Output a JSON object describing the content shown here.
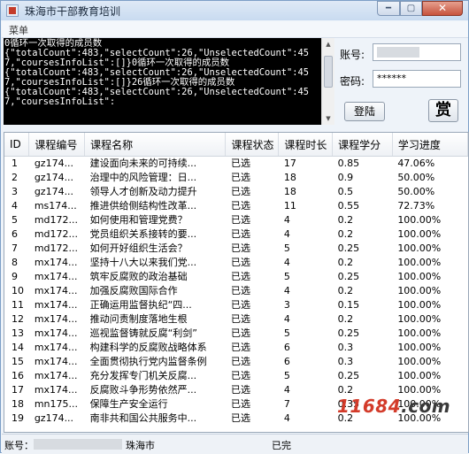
{
  "window": {
    "title": "珠海市干部教育培训"
  },
  "menu": {
    "label": "菜单"
  },
  "console": {
    "lines": "0循环一次取得的成员数\n{\"totalCount\":483,\"selectCount\":26,\"UnselectedCount\":457,\"coursesInfoList\":[]}0循环一次取得的成员数\n{\"totalCount\":483,\"selectCount\":26,\"UnselectedCount\":457,\"coursesInfoList\":[]}26循环一次取得的成员数\n{\"totalCount\":483,\"selectCount\":26,\"UnselectedCount\":457,\"coursesInfoList\":"
  },
  "login": {
    "account_label": "账号:",
    "password_label": "密码:",
    "password_value": "******",
    "login_button": "登陆",
    "reward_button": "赏"
  },
  "table": {
    "headers": [
      "ID",
      "课程编号",
      "课程名称",
      "课程状态",
      "课程时长",
      "课程学分",
      "学习进度"
    ],
    "rows": [
      [
        "1",
        "gz174...",
        "建设面向未来的可持续...",
        "已选",
        "17",
        "0.85",
        "47.06%"
      ],
      [
        "2",
        "gz174...",
        "治理中的风险管理：日...",
        "已选",
        "18",
        "0.9",
        "50.00%"
      ],
      [
        "3",
        "gz174...",
        "领导人才创新及动力提升",
        "已选",
        "18",
        "0.5",
        "50.00%"
      ],
      [
        "4",
        "ms174...",
        "推进供给侧结构性改革...",
        "已选",
        "11",
        "0.55",
        "72.73%"
      ],
      [
        "5",
        "md172...",
        "如何使用和管理党费？",
        "已选",
        "4",
        "0.2",
        "100.00%"
      ],
      [
        "6",
        "md172...",
        "党员组织关系接转的要...",
        "已选",
        "4",
        "0.2",
        "100.00%"
      ],
      [
        "7",
        "md172...",
        "如何开好组织生活会？",
        "已选",
        "5",
        "0.25",
        "100.00%"
      ],
      [
        "8",
        "mx174...",
        "坚持十八大以来我们党...",
        "已选",
        "4",
        "0.2",
        "100.00%"
      ],
      [
        "9",
        "mx174...",
        "筑牢反腐败的政治基础",
        "已选",
        "5",
        "0.25",
        "100.00%"
      ],
      [
        "10",
        "mx174...",
        "加强反腐败国际合作",
        "已选",
        "4",
        "0.2",
        "100.00%"
      ],
      [
        "11",
        "mx174...",
        "正确运用监督执纪“四...",
        "已选",
        "3",
        "0.15",
        "100.00%"
      ],
      [
        "12",
        "mx174...",
        "推动问责制度落地生根",
        "已选",
        "4",
        "0.2",
        "100.00%"
      ],
      [
        "13",
        "mx174...",
        "巡视监督铸就反腐“利剑”",
        "已选",
        "5",
        "0.25",
        "100.00%"
      ],
      [
        "14",
        "mx174...",
        "构建科学的反腐败战略体系",
        "已选",
        "6",
        "0.3",
        "100.00%"
      ],
      [
        "15",
        "mx174...",
        "全面贯彻执行党内监督条例",
        "已选",
        "6",
        "0.3",
        "100.00%"
      ],
      [
        "16",
        "mx174...",
        "充分发挥专门机关反腐...",
        "已选",
        "5",
        "0.25",
        "100.00%"
      ],
      [
        "17",
        "mx174...",
        "反腐败斗争形势依然严...",
        "已选",
        "4",
        "0.2",
        "100.00%"
      ],
      [
        "18",
        "mn175...",
        "保障生产安全运行",
        "已选",
        "7",
        "0.35",
        "100.00%"
      ],
      [
        "19",
        "gz174...",
        "南非共和国公共服务中...",
        "已选",
        "4",
        "0.2",
        "100.00%"
      ]
    ]
  },
  "status": {
    "account_prefix": "账号：",
    "city": "珠海市",
    "completed": "已完"
  },
  "watermark": {
    "brand": "11684",
    "domain": ".com"
  },
  "colors": {
    "console_bg": "#000000",
    "console_text": "#ffffff",
    "window_bg": "#eef3f9"
  }
}
